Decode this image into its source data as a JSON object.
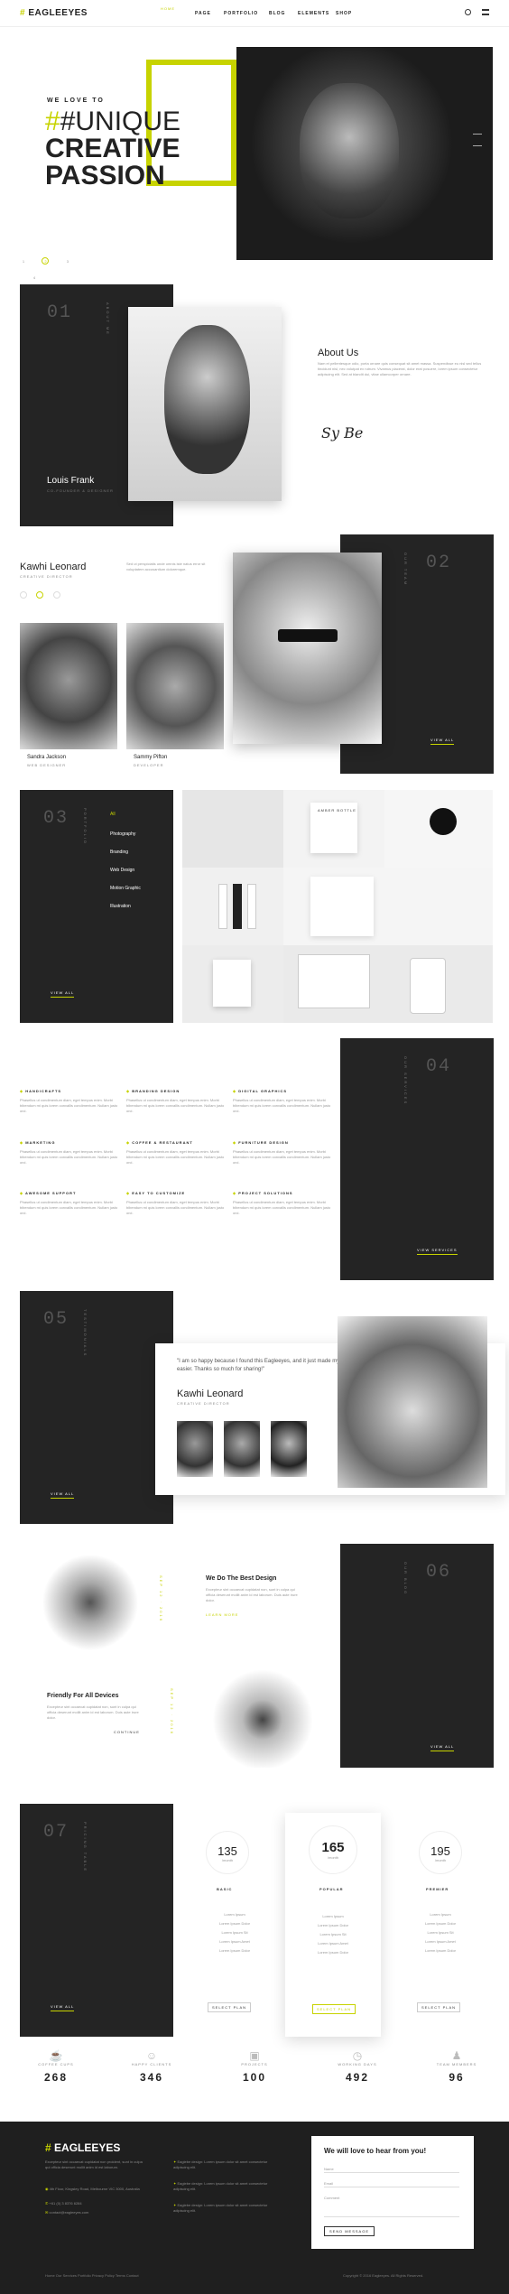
{
  "nav": {
    "logo": "EAGLEEYES",
    "items": [
      "PAGE",
      "PORTFOLIO",
      "BLOG",
      "ELEMENTS",
      "SHOP"
    ],
    "active": "HOME"
  },
  "hero": {
    "kicker": "WE LOVE TO",
    "line1": "#UNIQUE",
    "line2": "CREATIVE",
    "line3": "PASSION",
    "dots": [
      "1",
      "2",
      "3",
      "4"
    ]
  },
  "about": {
    "num": "01",
    "vert": "ABOUT ME",
    "title": "About Us",
    "person": "Louis Frank",
    "role": "CO-FOUNDER & DESIGNER",
    "signature": "Sy Be",
    "body": "Nam et pellentesque odio, porta ornare quis consequat sit amet massa. Suspendisse eu nisl sed tellus tincidunt nisl, nec volutpat ex rutrum. Vivamus placerat, dolor erat posuere, lorem ipsum consectetur adipiscing elit. Sed at blandit dui, vitae ullamcorper ornare."
  },
  "team": {
    "num": "02",
    "vert": "OUR TEAM",
    "name": "Kawhi Leonard",
    "role": "CREATIVE DIRECTOR",
    "body": "Sed ut perspiciatis unde omnis iste natus error sit voluptatem accusantium doloremque.",
    "members": [
      {
        "name": "Sandra Jackson",
        "role": "WEB DESIGNER"
      },
      {
        "name": "Sammy Pifton",
        "role": "DEVELOPER"
      }
    ],
    "view": "VIEW ALL"
  },
  "portfolio": {
    "num": "03",
    "vert": "PORTFOLIO",
    "filters": [
      "All",
      "Photography",
      "Branding",
      "Web Design",
      "Motion Graphic",
      "Illustration"
    ],
    "view": "VIEW ALL",
    "tile": "AMBER BOTTLE"
  },
  "services": {
    "num": "04",
    "vert": "OUR SERVICES",
    "items": [
      "HANDICRAFTS",
      "BRANDING DESIGN",
      "DIGITAL GRAPHICS",
      "MARKETING",
      "COFFEE & RESTAURANT",
      "FURNITURE DESIGN",
      "AWESOME SUPPORT",
      "EASY TO CUSTOMIZE",
      "PROJECT SOLUTIONS"
    ],
    "desc": "Phasellus ut condimentum diam, eget tempus enim. Morbi bibendum mi quis lorem convallis condimentum. Nullam justo orci.",
    "view": "VIEW SERVICES"
  },
  "testimonial": {
    "num": "05",
    "vert": "TESTIMONIALS",
    "quote": "\"I am so happy because I found this Eagleeyes, and it just made my life easier. Thanks so much for sharing!\"",
    "name": "Kawhi Leonard",
    "role": "CREATIVE DIRECTOR",
    "view": "VIEW ALL"
  },
  "blog": {
    "num": "06",
    "vert": "OUR BLOG",
    "t1": "We Do The Best Design",
    "t2": "Friendly For All Devices",
    "body": "Excepteur sint occaecat cupidatat non, sunt in culpa qui officia deserunt mollit anim id est laborum. Duis aute irure dolor.",
    "more": "LEARN MORE",
    "cont": "CONTINUE",
    "view": "VIEW ALL"
  },
  "pricing": {
    "num": "07",
    "vert": "PRICING TABLE",
    "plans": [
      {
        "price": "135",
        "per": "/month",
        "name": "BASIC"
      },
      {
        "price": "165",
        "per": "/month",
        "name": "POPULAR"
      },
      {
        "price": "195",
        "per": "/month",
        "name": "PREMIER"
      }
    ],
    "features": [
      "Lorem Ipsum",
      "Lorem Ipsum Dolor",
      "Lorem Ipsum Sit",
      "Lorem Ipsum Amet",
      "Lorem Ipsum Dolor"
    ],
    "select": "SELECT PLAN",
    "view": "VIEW ALL"
  },
  "stats": [
    {
      "label": "COFFEE CUPS",
      "value": "268"
    },
    {
      "label": "HAPPY CLIENTS",
      "value": "346"
    },
    {
      "label": "PROJECTS",
      "value": "100"
    },
    {
      "label": "WORKING DAYS",
      "value": "492"
    },
    {
      "label": "TEAM MEMBERS",
      "value": "96"
    }
  ],
  "footer": {
    "logo": "EAGLEEYES",
    "about": "Excepteur sint occaecat cupidatat non proident, sunt in culpa qui officia deserunt mollit anim id est laborum.",
    "address": "4th Floor, Kingsley Road, Melbourne VIC 3000, Australia",
    "phone": "+61 (0) 3 8376 6284",
    "email": "contact@eagleeyes.com",
    "tweets": [
      "Eaglebe design: Lorem ipsum dolor sit amet consectetur adipiscing elit.",
      "Eaglebe design: Lorem ipsum dolor sit amet consectetur adipiscing elit.",
      "Eaglebe design: Lorem ipsum dolor sit amet consectetur adipiscing elit."
    ],
    "form_title": "We will love to hear from you!",
    "fields": [
      "Name",
      "Email",
      "Comment"
    ],
    "send": "SEND MESSAGE",
    "links": [
      "Home",
      "Our Services",
      "Portfolio",
      "Privacy Policy",
      "Terms",
      "Contact"
    ],
    "copyright": "Copyright © 2016 Eagleeyes. All Rights Reserved."
  },
  "accent": "#c7d300"
}
